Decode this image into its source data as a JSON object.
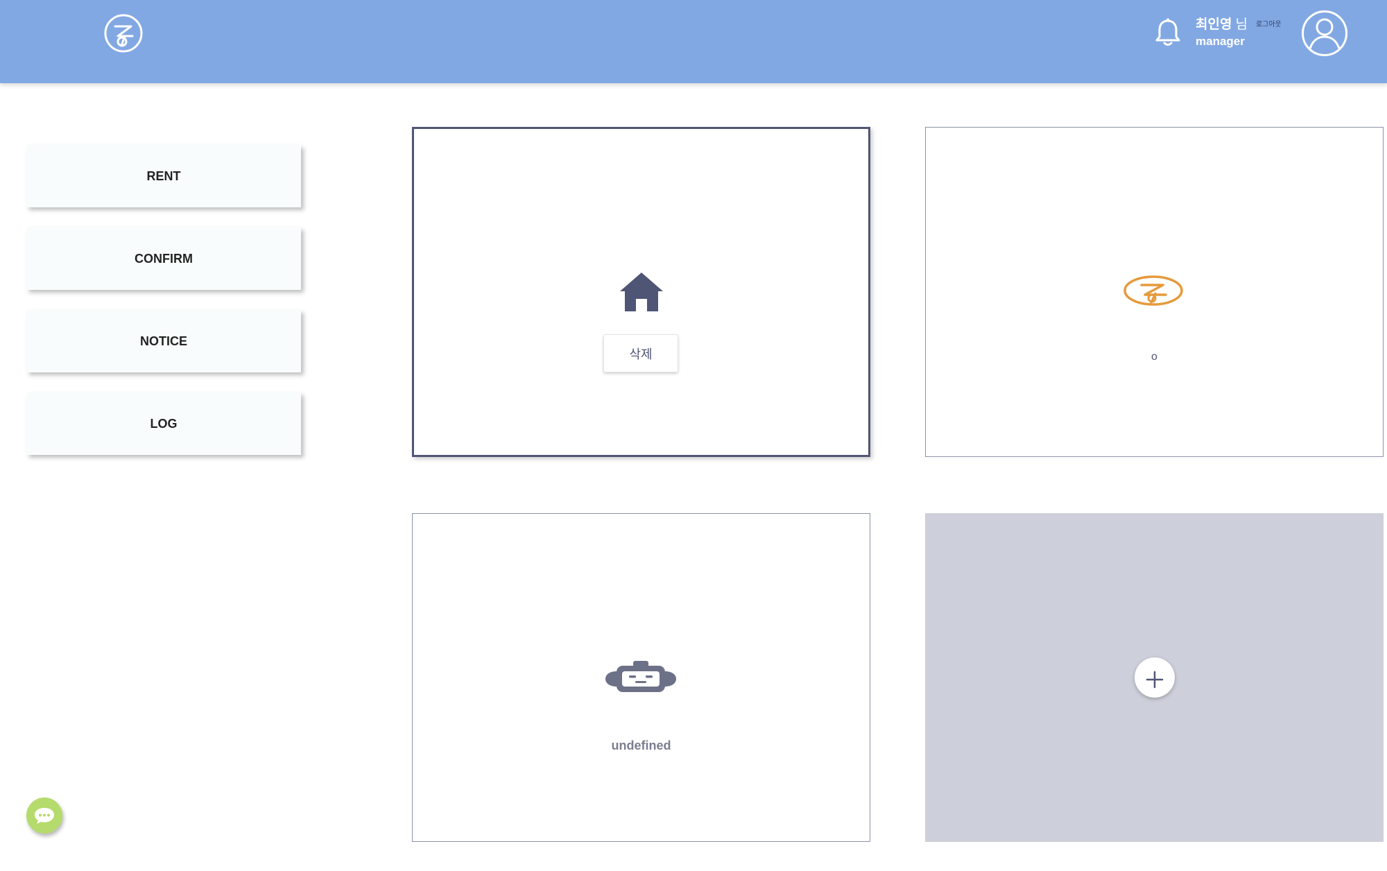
{
  "header": {
    "logo_icon": "zeta-circle-logo-icon",
    "bell_icon": "bell-icon",
    "user_name": "최인영",
    "user_suffix": "님",
    "logout_label": "로그아웃",
    "user_role": "manager",
    "avatar_icon": "user-circle-icon",
    "background_color": "#82a8e3"
  },
  "sidebar": {
    "items": [
      {
        "label": "RENT"
      },
      {
        "label": "CONFIRM"
      },
      {
        "label": "NOTICE"
      },
      {
        "label": "LOG"
      }
    ]
  },
  "cards": {
    "home": {
      "icon": "home-icon",
      "delete_label": "삭제",
      "accent_color": "#4f5575"
    },
    "logo": {
      "icon": "orange-zeta-logo-icon",
      "text": "o",
      "accent_color": "#e59a3c"
    },
    "bot": {
      "icon": "robot-icon",
      "text": "undefined"
    },
    "add": {
      "icon": "plus-icon",
      "background_color": "#cdcfda"
    }
  },
  "chat": {
    "icon": "chat-bubble-icon",
    "color": "#b5db6d"
  }
}
